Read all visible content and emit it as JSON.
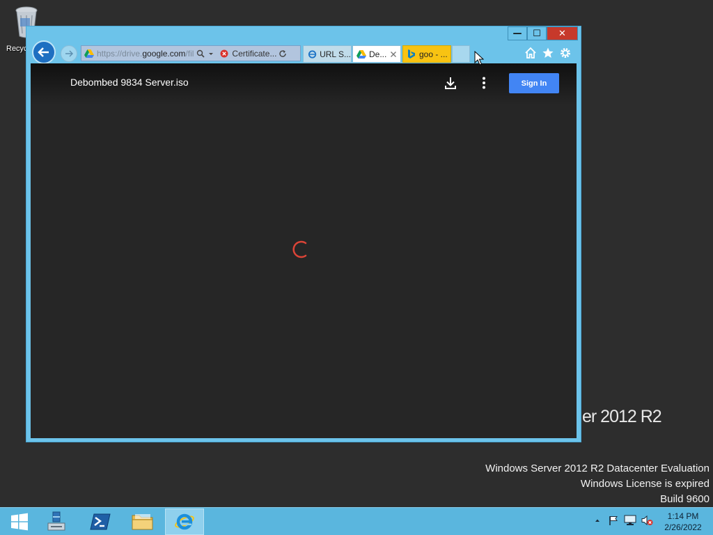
{
  "desktop": {
    "recycle_bin_label": "Recyc",
    "brand_text": "er 2012 R2",
    "watermark": {
      "line1": "Windows Server 2012 R2 Datacenter Evaluation",
      "line2": "Windows License is expired",
      "line3": "Build 9600"
    }
  },
  "browser": {
    "address": {
      "url_prefix": "https://drive.",
      "url_domain": "google.com",
      "url_suffix": "/fil"
    },
    "certificate_label": "Certificate...",
    "tabs": [
      {
        "label": "URL S..."
      },
      {
        "label": "De..."
      },
      {
        "label": "goo - ..."
      }
    ],
    "window_buttons": {
      "minimize": "—",
      "maximize": "☐",
      "close": "✕"
    }
  },
  "viewer": {
    "file_title": "Debombed 9834 Server.iso",
    "signin_label": "Sign In",
    "accent_color": "#4285f4",
    "spinner_color": "#db4437"
  },
  "taskbar": {
    "clock_time": "1:14 PM",
    "clock_date": "2/26/2022"
  }
}
